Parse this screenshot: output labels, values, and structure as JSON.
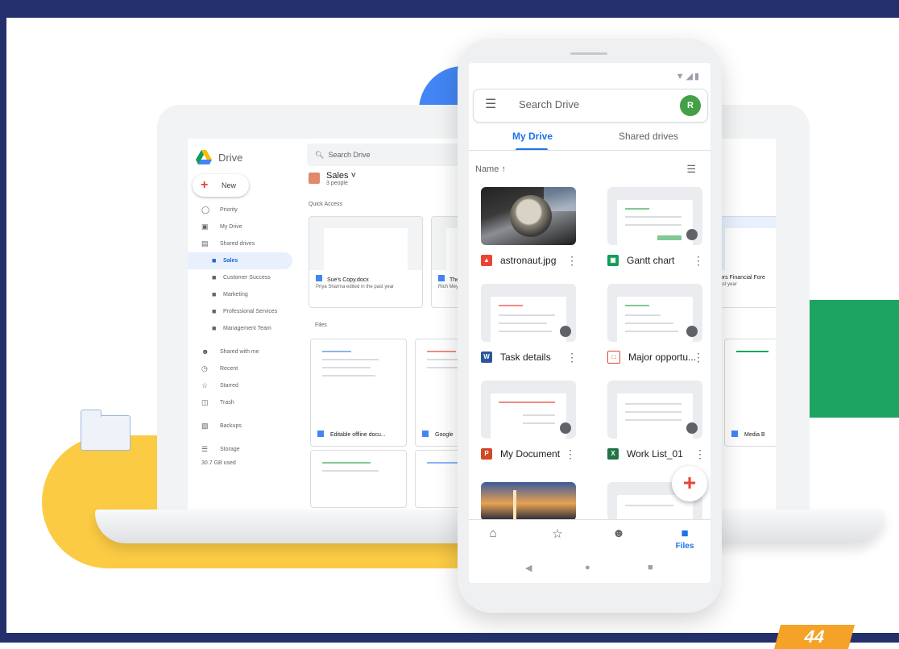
{
  "desktop": {
    "app_name": "Drive",
    "search_placeholder": "Search Drive",
    "new_label": "New",
    "nav": [
      {
        "label": "Priority",
        "icon": "check-circle-icon"
      },
      {
        "label": "My Drive",
        "icon": "drive-icon"
      },
      {
        "label": "Shared drives",
        "icon": "shared-drives-icon"
      },
      {
        "label": "Sales",
        "icon": "folder-icon"
      },
      {
        "label": "Customer Success",
        "icon": "folder-icon"
      },
      {
        "label": "Marketing",
        "icon": "folder-icon"
      },
      {
        "label": "Professional Services",
        "icon": "folder-icon"
      },
      {
        "label": "Management Team",
        "icon": "folder-icon"
      },
      {
        "label": "Shared with me",
        "icon": "people-icon"
      },
      {
        "label": "Recent",
        "icon": "clock-icon"
      },
      {
        "label": "Starred",
        "icon": "star-icon"
      },
      {
        "label": "Trash",
        "icon": "trash-icon"
      },
      {
        "label": "Backups",
        "icon": "backup-icon"
      },
      {
        "label": "Storage",
        "icon": "storage-icon"
      }
    ],
    "storage_used": "30.7 GB used",
    "folder_title": "Sales",
    "folder_people": "3 people",
    "quick_access_label": "Quick Access",
    "quick_cards": [
      {
        "title": "Sue's Copy.docx",
        "subtitle": "Priya Sharma edited in the past year"
      },
      {
        "title": "The",
        "subtitle": "Rich Mey"
      }
    ],
    "files_label": "Files",
    "files": [
      {
        "name": "Editable offline docu..."
      },
      {
        "name": "Google"
      }
    ],
    "peek_card_title": "dors Financial Fore",
    "peek_card_sub": "past year",
    "peek_file": "Media B"
  },
  "phone": {
    "search_placeholder": "Search Drive",
    "avatar_letter": "R",
    "tabs": [
      "My Drive",
      "Shared drives"
    ],
    "sort_label": "Name",
    "files": [
      {
        "name": "astronaut.jpg",
        "icon": "image-icon",
        "color": "#ea4335"
      },
      {
        "name": "Gantt chart",
        "icon": "sheets-icon",
        "color": "#0f9d58"
      },
      {
        "name": "Task details",
        "icon": "word-icon",
        "color": "#2b579a"
      },
      {
        "name": "Major opportu...",
        "icon": "pdf-icon",
        "color": "#ea4335"
      },
      {
        "name": "My Document",
        "icon": "powerpoint-icon",
        "color": "#d24726"
      },
      {
        "name": "Work List_01",
        "icon": "excel-icon",
        "color": "#217346"
      }
    ],
    "bottom_nav": [
      {
        "label": "",
        "icon": "home-icon"
      },
      {
        "label": "",
        "icon": "star-icon"
      },
      {
        "label": "",
        "icon": "shared-icon"
      },
      {
        "label": "Files",
        "icon": "folder-icon"
      }
    ]
  },
  "page_badge": "44",
  "colors": {
    "frame": "#24306b",
    "accent": "#1a73e8",
    "yellow": "#fbcb44",
    "green": "#1da462",
    "blue": "#4285f4",
    "badge": "#f4a228"
  }
}
